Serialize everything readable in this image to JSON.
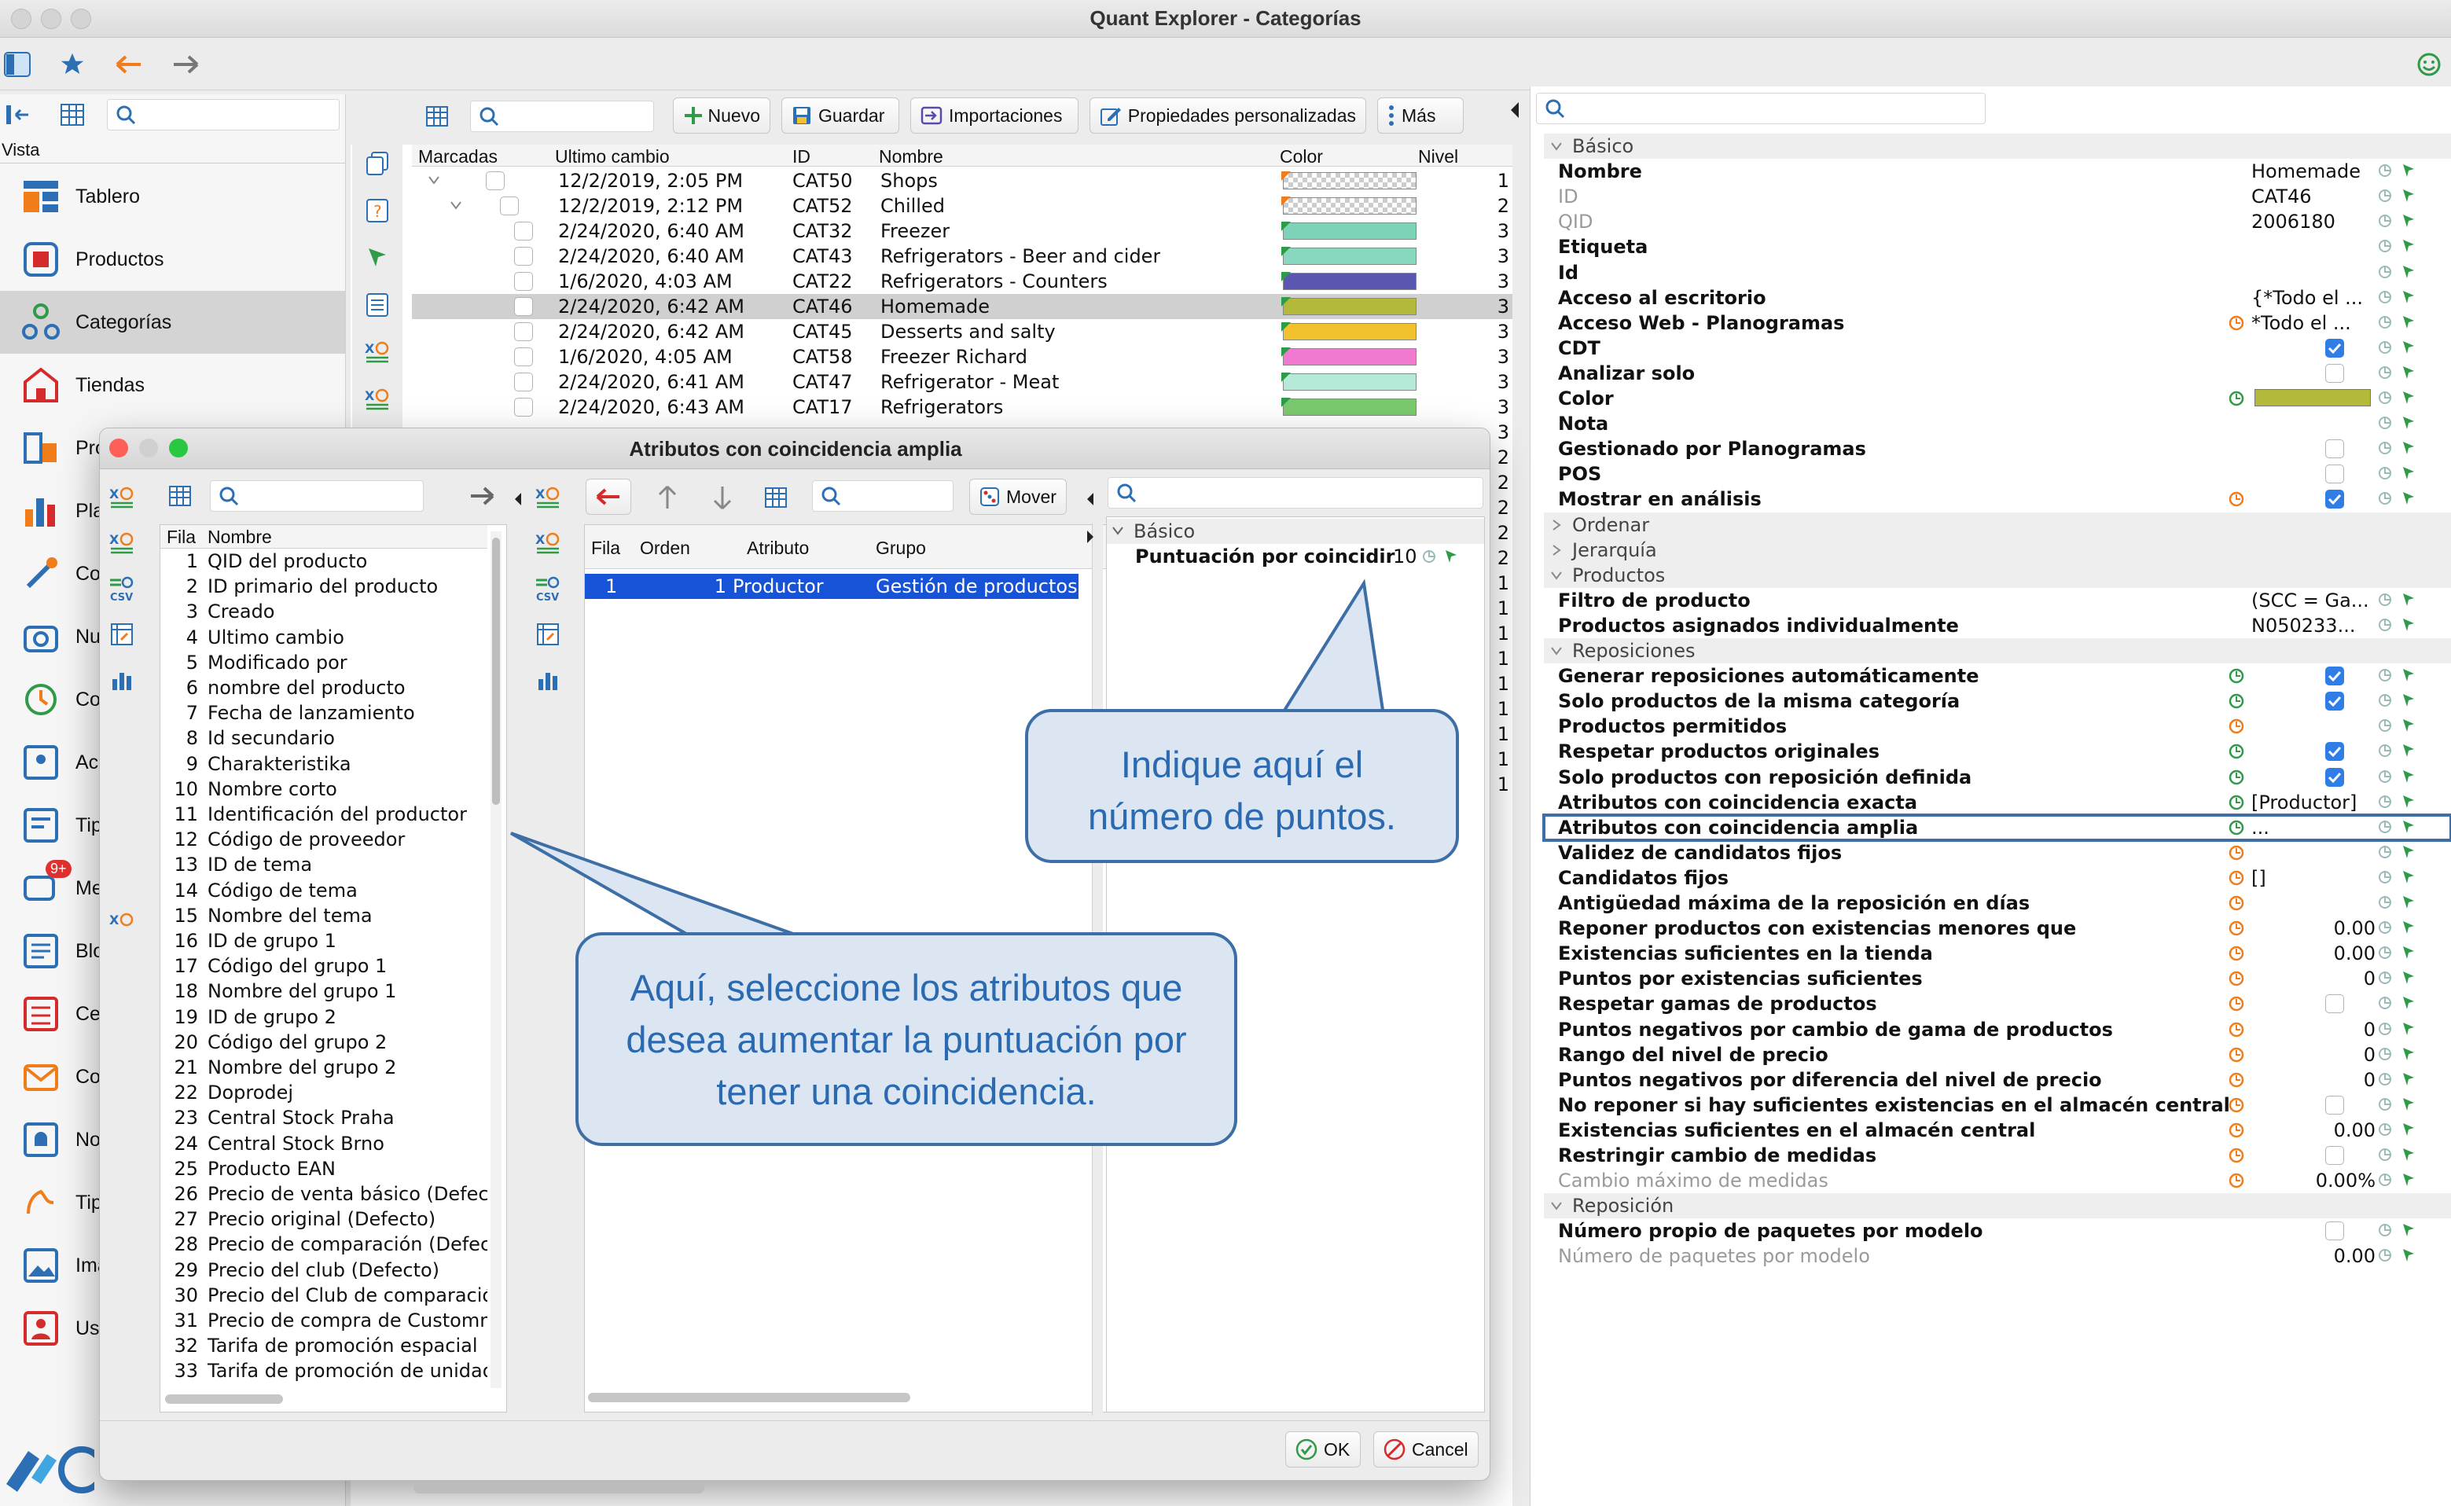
{
  "app": {
    "title": "Quant Explorer - Categorías"
  },
  "nav": {
    "vista_label": "Vista",
    "items": [
      {
        "label": "Tablero",
        "icon": "dashboard-icon"
      },
      {
        "label": "Productos",
        "icon": "box-icon"
      },
      {
        "label": "Categorías",
        "icon": "categories-icon"
      },
      {
        "label": "Tiendas",
        "icon": "store-icon"
      },
      {
        "label": "Pro",
        "icon": "planogram-icon"
      },
      {
        "label": "Pla",
        "icon": "chart-icon"
      },
      {
        "label": "Co",
        "icon": "tools-icon"
      },
      {
        "label": "Nu",
        "icon": "camera-icon"
      },
      {
        "label": "Co",
        "icon": "clock-icon"
      },
      {
        "label": "Acc",
        "icon": "access-icon"
      },
      {
        "label": "Tip",
        "icon": "tip-icon"
      },
      {
        "label": "Me",
        "icon": "message-icon",
        "badge": "9+"
      },
      {
        "label": "Blo",
        "icon": "blog-icon"
      },
      {
        "label": "Cer",
        "icon": "list-icon"
      },
      {
        "label": "Co",
        "icon": "mail-icon"
      },
      {
        "label": "No",
        "icon": "bell-icon"
      },
      {
        "label": "Tip",
        "icon": "hand-icon"
      },
      {
        "label": "Ima",
        "icon": "image-icon"
      },
      {
        "label": "Usu",
        "icon": "user-icon"
      }
    ]
  },
  "toolbar": {
    "new_label": "Nuevo",
    "save_label": "Guardar",
    "imports_label": "Importaciones",
    "custom_props_label": "Propiedades personalizadas",
    "more_label": "Más"
  },
  "grid": {
    "columns": [
      "Marcadas",
      "Ultimo cambio",
      "ID",
      "Nombre",
      "Color",
      "Nivel"
    ],
    "rows": [
      {
        "date": "12/2/2019, 2:05 PM",
        "id": "CAT50",
        "name": "Shops",
        "color": "checker",
        "level": "1"
      },
      {
        "date": "12/2/2019, 2:12 PM",
        "id": "CAT52",
        "name": "Chilled",
        "color": "checker",
        "level": "2"
      },
      {
        "date": "2/24/2020, 6:40 AM",
        "id": "CAT32",
        "name": "Freezer",
        "color": "#7dd3b8",
        "level": "3"
      },
      {
        "date": "2/24/2020, 6:40 AM",
        "id": "CAT43",
        "name": "Refrigerators - Beer and cider",
        "color": "#88d8c0",
        "level": "3"
      },
      {
        "date": "1/6/2020, 4:03 AM",
        "id": "CAT22",
        "name": "Refrigerators - Counters",
        "color": "#5a57b0",
        "level": "3"
      },
      {
        "date": "2/24/2020, 6:42 AM",
        "id": "CAT46",
        "name": "Homemade",
        "color": "#b3b93a",
        "level": "3"
      },
      {
        "date": "2/24/2020, 6:42 AM",
        "id": "CAT45",
        "name": "Desserts and salty",
        "color": "#f2c12e",
        "level": "3"
      },
      {
        "date": "1/6/2020, 4:05 AM",
        "id": "CAT58",
        "name": "Freezer Richard",
        "color": "#f07ad0",
        "level": "3"
      },
      {
        "date": "2/24/2020, 6:41 AM",
        "id": "CAT47",
        "name": "Refrigerator - Meat",
        "color": "#b6ead8",
        "level": "3"
      },
      {
        "date": "2/24/2020, 6:43 AM",
        "id": "CAT17",
        "name": "Refrigerators",
        "color": "#7bc96e",
        "level": "3"
      }
    ],
    "extra_levels": [
      "3",
      "2",
      "2",
      "2",
      "2",
      "2",
      "1",
      "1",
      "1",
      "1",
      "1",
      "1",
      "1",
      "1",
      "1"
    ]
  },
  "props": {
    "rows": [
      {
        "label": "Básico",
        "section": true
      },
      {
        "label": "Nombre",
        "value": "Homemade"
      },
      {
        "label": "ID",
        "value": "CAT46",
        "dim": true
      },
      {
        "label": "QID",
        "value": "2006180",
        "dim": true
      },
      {
        "label": "Etiqueta"
      },
      {
        "label": "Id"
      },
      {
        "label": "Acceso al escritorio",
        "value": "{*Todo el ..."
      },
      {
        "label": "Acceso Web - Planogramas",
        "value": "*Todo el ...",
        "orange": true
      },
      {
        "label": "CDT",
        "check": "on"
      },
      {
        "label": "Analizar solo",
        "check": "off"
      },
      {
        "label": "Color",
        "swatch": "#b3b93a",
        "green": true
      },
      {
        "label": "Nota"
      },
      {
        "label": "Gestionado por Planogramas",
        "check": "off"
      },
      {
        "label": "POS",
        "check": "off"
      },
      {
        "label": "Mostrar en análisis",
        "check": "on",
        "orange": true
      },
      {
        "label": "Ordenar",
        "section": true,
        "collapsed": true
      },
      {
        "label": "Jerarquía",
        "section": true,
        "collapsed": true
      },
      {
        "label": "Productos",
        "section": true
      },
      {
        "label": "Filtro de producto",
        "value": "(SCC = Ga..."
      },
      {
        "label": "Productos asignados individualmente",
        "value": "N050233..."
      },
      {
        "label": "Reposiciones",
        "section": true
      },
      {
        "label": "Generar reposiciones automáticamente",
        "check": "on",
        "green": true
      },
      {
        "label": "Solo productos de la misma categoría",
        "check": "on",
        "green": true
      },
      {
        "label": "Productos permitidos",
        "orange": true
      },
      {
        "label": "Respetar productos originales",
        "check": "on",
        "green": true
      },
      {
        "label": "Solo productos con reposición definida",
        "check": "on",
        "green": true
      },
      {
        "label": "Atributos con coincidencia exacta",
        "value": "[Productor]",
        "green": true
      },
      {
        "label": "Atributos con coincidencia amplia",
        "value": "...",
        "green": true,
        "highlight": true
      },
      {
        "label": "Validez de candidatos fijos",
        "orange": true
      },
      {
        "label": "Candidatos fijos",
        "value": "[]",
        "orange": true
      },
      {
        "label": "Antigüedad máxima de la reposición en días",
        "orange": true
      },
      {
        "label": "Reponer productos con existencias menores que",
        "num": "0.00",
        "orange": true
      },
      {
        "label": "Existencias suficientes en la tienda",
        "num": "0.00",
        "orange": true
      },
      {
        "label": "Puntos por existencias suficientes",
        "num": "0",
        "orange": true
      },
      {
        "label": "Respetar gamas de productos",
        "check": "off",
        "orange": true
      },
      {
        "label": "Puntos negativos por cambio de gama de productos",
        "num": "0",
        "orange": true
      },
      {
        "label": "Rango del nivel de precio",
        "num": "0",
        "orange": true
      },
      {
        "label": "Puntos negativos por diferencia del nivel de precio",
        "num": "0",
        "orange": true
      },
      {
        "label": "No reponer si hay suficientes existencias en el almacén central",
        "check": "off",
        "orange": true
      },
      {
        "label": "Existencias suficientes en el almacén central",
        "num": "0.00",
        "orange": true
      },
      {
        "label": "Restringir cambio de medidas",
        "check": "off",
        "orange": true
      },
      {
        "label": "Cambio máximo de medidas",
        "num": "0.00%",
        "orange": true,
        "dim": true
      },
      {
        "label": "Reposición",
        "section": true
      },
      {
        "label": "Número propio de paquetes por modelo",
        "check": "off"
      },
      {
        "label": "Número de paquetes por modelo",
        "num": "0.00",
        "dim": true
      }
    ]
  },
  "dialog": {
    "title": "Atributos con coincidencia amplia",
    "left_cols": [
      "Fila",
      "Nombre"
    ],
    "attributes": [
      "QID del producto",
      "ID primario del producto",
      "Creado",
      "Ultimo cambio",
      "Modificado por",
      "nombre del producto",
      "Fecha de lanzamiento",
      "Id secundario",
      "Charakteristika",
      "Nombre corto",
      "Identificación del productor",
      "Código de proveedor",
      "ID de tema",
      "Código de tema",
      "Nombre del tema",
      "ID de grupo 1",
      "Código del grupo 1",
      "Nombre del grupo 1",
      "ID de grupo 2",
      "Código del grupo 2",
      "Nombre del grupo 2",
      "Doprodej",
      "Central Stock Praha",
      "Central Stock Brno",
      "Producto EAN",
      "Precio de venta básico (Defecto)",
      "Precio original (Defecto)",
      "Precio de comparación (Defecto)",
      "Precio del club (Defecto)",
      "Precio del Club de comparación",
      "Precio de compra de Customn",
      "Tarifa de promoción espacial",
      "Tarifa de promoción de unidad"
    ],
    "move_label": "Mover",
    "sel_cols": [
      "Fila",
      "Orden",
      "Atributo",
      "Grupo"
    ],
    "sel_row": {
      "fila": "1",
      "orden": "1",
      "atributo": "Productor",
      "grupo": "Gestión de productos"
    },
    "prop_section": "Básico",
    "prop_label": "Puntuación por coincidir",
    "prop_value": "10",
    "ok_label": "OK",
    "cancel_label": "Cancel"
  },
  "callouts": {
    "points": "Indique aquí el número de puntos.",
    "attributes": "Aquí, seleccione los atributos que desea aumentar la puntuación por tener una coincidencia."
  }
}
